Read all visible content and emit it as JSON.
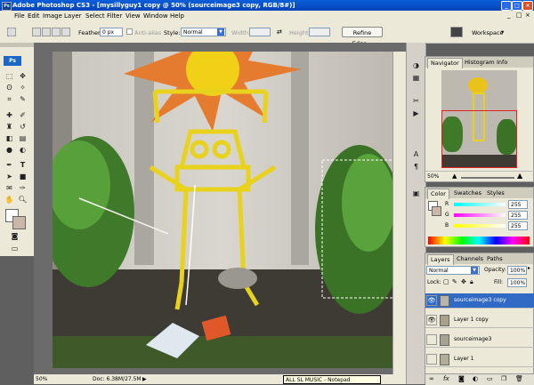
{
  "window": {
    "app_icon": "Ps",
    "title": "Adobe Photoshop CS3 - [mysillyguy1 copy @ 50% (sourceimage3 copy, RGB/8#)]"
  },
  "menu": [
    "File",
    "Edit",
    "Image",
    "Layer",
    "Select",
    "Filter",
    "View",
    "Window",
    "Help"
  ],
  "options": {
    "feather_label": "Feather:",
    "feather_value": "0 px",
    "antialias_label": "Anti-alias",
    "style_label": "Style:",
    "style_value": "Normal",
    "width_label": "Width:",
    "height_label": "Height:",
    "refine_edge": "Refine Edge...",
    "workspace": "Workspace"
  },
  "tools": {
    "ps_logo": "Ps"
  },
  "status": {
    "zoom": "50%",
    "doc": "Doc: 6.38M/27.5M"
  },
  "taskbar_tooltip": "ALL SL MUSIC - Notepad",
  "navigator": {
    "tabs": [
      "Navigator",
      "Histogram",
      "Info"
    ],
    "zoom": "50%"
  },
  "color_panel": {
    "tabs": [
      "Color",
      "Swatches",
      "Styles"
    ],
    "channels": [
      {
        "label": "R",
        "value": "255"
      },
      {
        "label": "G",
        "value": "255"
      },
      {
        "label": "B",
        "value": "255"
      }
    ]
  },
  "layers_panel": {
    "tabs": [
      "Layers",
      "Channels",
      "Paths"
    ],
    "blend_mode": "Normal",
    "opacity_label": "Opacity:",
    "opacity_value": "100%",
    "lock_label": "Lock:",
    "fill_label": "Fill:",
    "fill_value": "100%",
    "layers": [
      {
        "name": "sourceimage3 copy",
        "visible": true,
        "selected": true
      },
      {
        "name": "Layer 1 copy",
        "visible": true,
        "selected": false
      },
      {
        "name": "sourceimage3",
        "visible": false,
        "selected": false
      },
      {
        "name": "Layer 1",
        "visible": false,
        "selected": false
      }
    ],
    "footer_icons": [
      "link-icon",
      "fx-icon",
      "mask-icon",
      "adjustment-icon",
      "folder-icon",
      "new-layer-icon",
      "trash-icon"
    ]
  },
  "colors": {
    "accent": "#316ac5",
    "title_bar": "#0a5fd8"
  }
}
